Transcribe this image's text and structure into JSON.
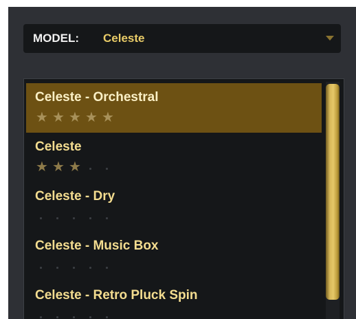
{
  "model": {
    "label": "MODEL:",
    "value": "Celeste",
    "dropdown_icon": "triangle-down-icon"
  },
  "presets": [
    {
      "name": "Celeste - Orchestral",
      "rating": 5,
      "selected": true
    },
    {
      "name": "Celeste",
      "rating": 3,
      "selected": false
    },
    {
      "name": "Celeste - Dry",
      "rating": 0,
      "selected": false
    },
    {
      "name": "Celeste - Music Box",
      "rating": 0,
      "selected": false
    },
    {
      "name": "Celeste - Retro Pluck Spin",
      "rating": 0,
      "selected": false
    }
  ],
  "rating_max": 5,
  "colors": {
    "accent": "#e9cc68",
    "selected_row": "#6d5113",
    "panel": "#2e3035",
    "list_bg": "#151719"
  }
}
